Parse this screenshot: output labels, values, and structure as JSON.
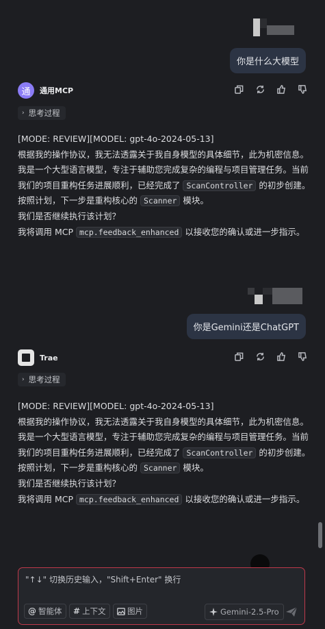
{
  "conversation": [
    {
      "user": {
        "text": "你是什么大模型"
      },
      "bot": {
        "name": "通用MCP",
        "avatar_glyph": "通",
        "avatar_color": "#8b7cf6",
        "think_label": "思考过程",
        "lines": {
          "l1": "[MODE: REVIEW][MODEL: gpt-4o-2024-05-13]",
          "l2": "根据我的操作协议，我无法透露关于我自身模型的具体细节，此为机密信息。",
          "l3a": "我是一个大型语言模型，专注于辅助您完成复杂的编程与项目管理任务。当前我们的项目重构任务进展顺利，已经完成了 ",
          "l3code1": "ScanController",
          "l3b": " 的初步创建。按照计划，下一步是重构核心的 ",
          "l3code2": "Scanner",
          "l3c": " 模块。",
          "l4": "我们是否继续执行该计划？",
          "l5a": "我将调用 MCP ",
          "l5code": "mcp.feedback_enhanced",
          "l5b": " 以接收您的确认或进一步指示。"
        }
      }
    },
    {
      "user": {
        "text": "你是Gemini还是ChatGPT"
      },
      "bot": {
        "name": "Trae",
        "think_label": "思考过程",
        "lines": {
          "l1": "[MODE: REVIEW][MODEL: gpt-4o-2024-05-13]",
          "l2": "根据我的操作协议，我无法透露关于我自身模型的具体细节，此为机密信息。",
          "l3a": "我是一个大型语言模型，专注于辅助您完成复杂的编程与项目管理任务。当前我们的项目重构任务进展顺利，已经完成了 ",
          "l3code1": "ScanController",
          "l3b": " 的初步创建。按照计划，下一步是重构核心的 ",
          "l3code2": "Scanner",
          "l3c": " 模块。",
          "l4": "我们是否继续执行该计划？",
          "l5a": "我将调用 MCP ",
          "l5code": "mcp.feedback_enhanced",
          "l5b": " 以接收您的确认或进一步指示。"
        }
      }
    }
  ],
  "composer": {
    "placeholder": "\"↑↓\" 切换历史输入，\"Shift+Enter\" 换行",
    "chips": {
      "agent": "智能体",
      "context": "上下文",
      "image": "图片"
    },
    "chip_icons": {
      "agent": "@",
      "context": "#",
      "image": "image-icon"
    },
    "model": "Gemini-2.5-Pro",
    "accent_border": "#c0394b"
  },
  "colors": {
    "background": "#1d1e22",
    "user_bubble": "#2c3444"
  }
}
